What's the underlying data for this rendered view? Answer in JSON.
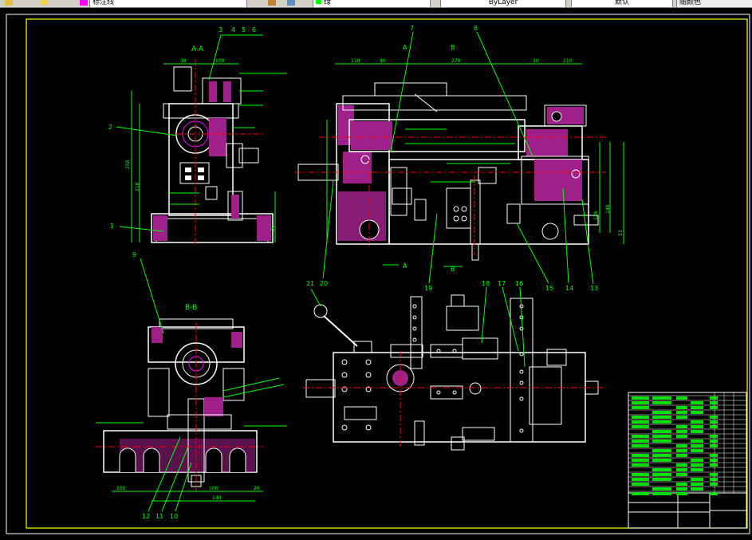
{
  "toolbar": {
    "layer_value": "标注线",
    "color_value": "绿",
    "linetype_value": "ByLayer",
    "lineweight_value": "默认",
    "plotstyle_value": "随颜色"
  },
  "views": {
    "aa_title": "A-A",
    "bb_title": "B-B"
  },
  "callouts": [
    "1",
    "2",
    "3",
    "4",
    "5",
    "6",
    "7",
    "8",
    "9",
    "10",
    "11",
    "12",
    "13",
    "14",
    "15",
    "16",
    "17",
    "18",
    "19",
    "20",
    "21"
  ],
  "section_marks": {
    "a": "A",
    "b": "B"
  },
  "dims": {
    "aa_top_a": "38",
    "aa_top_b": "100",
    "aa_side": "218",
    "aa_side2": "258",
    "aa_bot": "36",
    "main_a": "110",
    "main_b": "40",
    "main_c": "270",
    "main_d": "30",
    "main_e": "110",
    "main_f": "126",
    "main_g": "148",
    "main_h": "53",
    "bb_a": "105",
    "bb_b": "100",
    "bb_c": "20",
    "bb_d": "140"
  },
  "colors": {
    "frame": "#00ff00",
    "outline": "#ffffff",
    "hatch": "#ff00ff",
    "dim": "#00ff00",
    "center": "#ff0000",
    "title_fill": "#00dd00"
  }
}
